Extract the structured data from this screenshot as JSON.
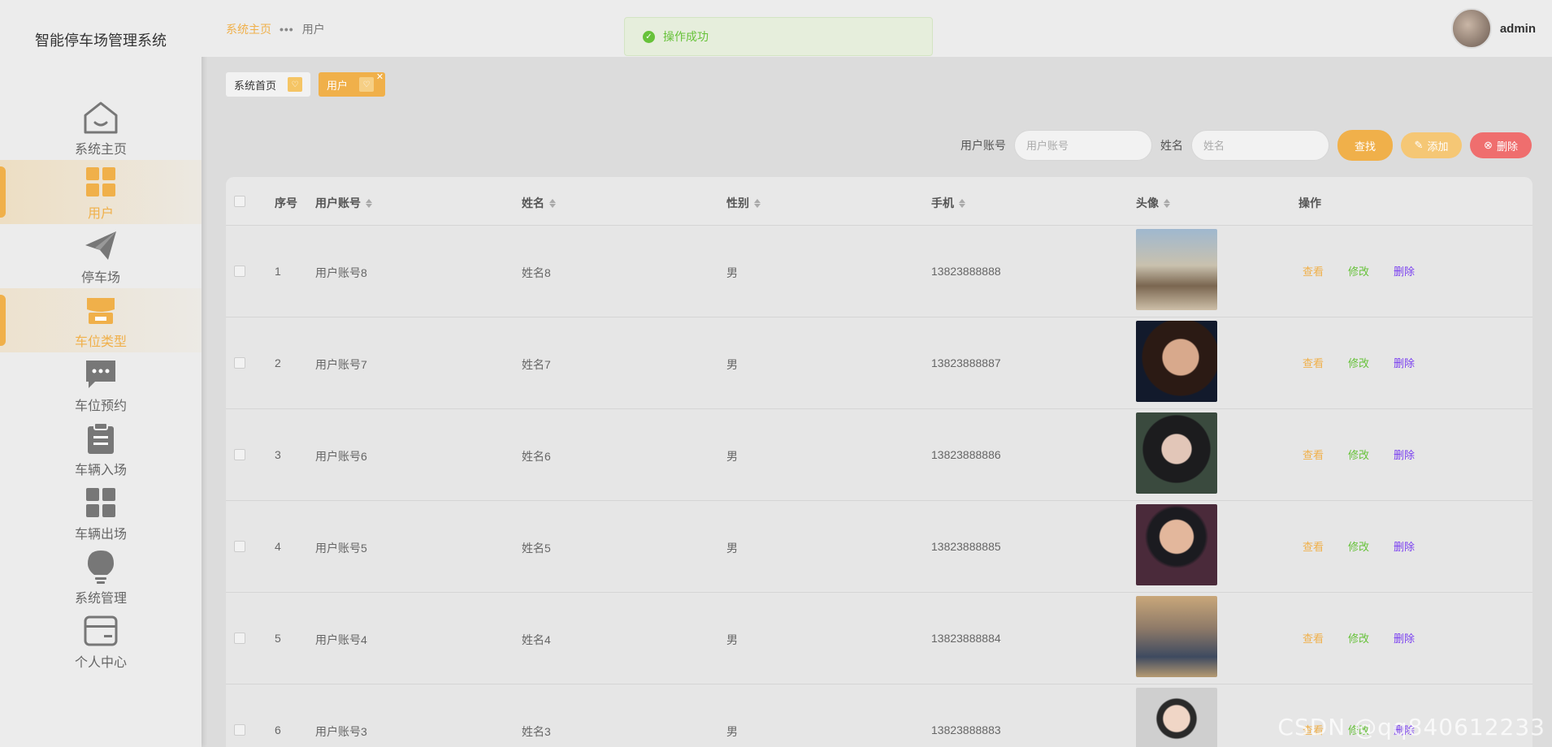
{
  "app": {
    "title": "智能停车场管理系统"
  },
  "sidebar": {
    "items": [
      {
        "label": "系统主页",
        "icon": "home-icon"
      },
      {
        "label": "用户",
        "icon": "grid-icon",
        "active": true
      },
      {
        "label": "停车场",
        "icon": "paper-plane-icon"
      },
      {
        "label": "车位类型",
        "icon": "store-icon",
        "hover": true
      },
      {
        "label": "车位预约",
        "icon": "chat-icon"
      },
      {
        "label": "车辆入场",
        "icon": "clipboard-icon"
      },
      {
        "label": "车辆出场",
        "icon": "grid-icon"
      },
      {
        "label": "系统管理",
        "icon": "bulb-icon"
      },
      {
        "label": "个人中心",
        "icon": "card-icon"
      }
    ]
  },
  "header": {
    "breadcrumb": {
      "home": "系统主页",
      "separator": "•••",
      "current": "用户"
    },
    "user": {
      "name": "admin"
    },
    "toast": {
      "text": "操作成功",
      "type": "success"
    }
  },
  "tabs": [
    {
      "label": "系统首页"
    },
    {
      "label": "用户",
      "active": true
    }
  ],
  "search": {
    "account_label": "用户账号",
    "account_placeholder": "用户账号",
    "name_label": "姓名",
    "name_placeholder": "姓名",
    "find_label": "查找",
    "add_label": "添加",
    "delete_label": "删除"
  },
  "table": {
    "headers": [
      "序号",
      "用户账号",
      "姓名",
      "性别",
      "手机",
      "头像",
      "操作"
    ],
    "actions": {
      "view": "查看",
      "edit": "修改",
      "remove": "删除"
    },
    "rows": [
      {
        "index": "1",
        "account": "用户账号8",
        "name": "姓名8",
        "gender": "男",
        "phone": "13823888888"
      },
      {
        "index": "2",
        "account": "用户账号7",
        "name": "姓名7",
        "gender": "男",
        "phone": "13823888887"
      },
      {
        "index": "3",
        "account": "用户账号6",
        "name": "姓名6",
        "gender": "男",
        "phone": "13823888886"
      },
      {
        "index": "4",
        "account": "用户账号5",
        "name": "姓名5",
        "gender": "男",
        "phone": "13823888885"
      },
      {
        "index": "5",
        "account": "用户账号4",
        "name": "姓名4",
        "gender": "男",
        "phone": "13823888884"
      },
      {
        "index": "6",
        "account": "用户账号3",
        "name": "姓名3",
        "gender": "男",
        "phone": "13823888883"
      }
    ]
  },
  "watermark": "CSDN @qq840612233",
  "colors": {
    "accent": "#f0b04a",
    "success": "#67c23a",
    "danger": "#ef6e6e",
    "delete_link": "#7a3ff0"
  }
}
